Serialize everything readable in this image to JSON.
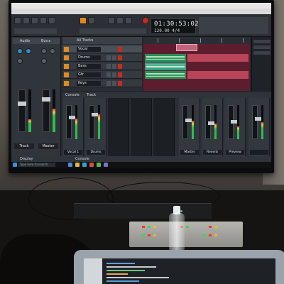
{
  "window": {
    "title_bar_text": "",
    "menu_items": [
      "",
      "",
      "",
      "",
      "",
      "",
      "",
      ""
    ]
  },
  "transport": {
    "time": "01:30:53:02",
    "tempo": "120.00  4/4"
  },
  "inspector": {
    "tabs": [
      "Audio",
      "Bus ▸"
    ],
    "track_label": "Track",
    "output_label": "Master"
  },
  "tracks": {
    "view_tab": "All Tracks",
    "items": [
      {
        "name": "Vocal"
      },
      {
        "name": "Drums"
      },
      {
        "name": "Bass"
      },
      {
        "name": "Gtr"
      },
      {
        "name": "Keys"
      }
    ]
  },
  "console": {
    "tabs": [
      "Console",
      "Track"
    ],
    "strips": [
      {
        "label": "Vocal 1",
        "level": 0.6
      },
      {
        "label": "Drums",
        "level": 0.72
      },
      {
        "label": "",
        "level": 0
      },
      {
        "label": "",
        "level": 0
      },
      {
        "label": "",
        "level": 0
      },
      {
        "label": "Master",
        "level": 0.55
      },
      {
        "label": "Reverb",
        "level": 0.45
      },
      {
        "label": "Preview",
        "level": 0.38
      },
      {
        "label": "",
        "level": 0.5
      }
    ]
  },
  "status": {
    "left": "Display",
    "center": "Console"
  },
  "taskbar": {
    "search_placeholder": "Type here to search",
    "clock": ""
  },
  "colors": {
    "accent_orange": "#e08a1e",
    "record_red": "#c92a1e",
    "clip_green": "#2c8f58",
    "clip_pink": "#b9455a"
  }
}
